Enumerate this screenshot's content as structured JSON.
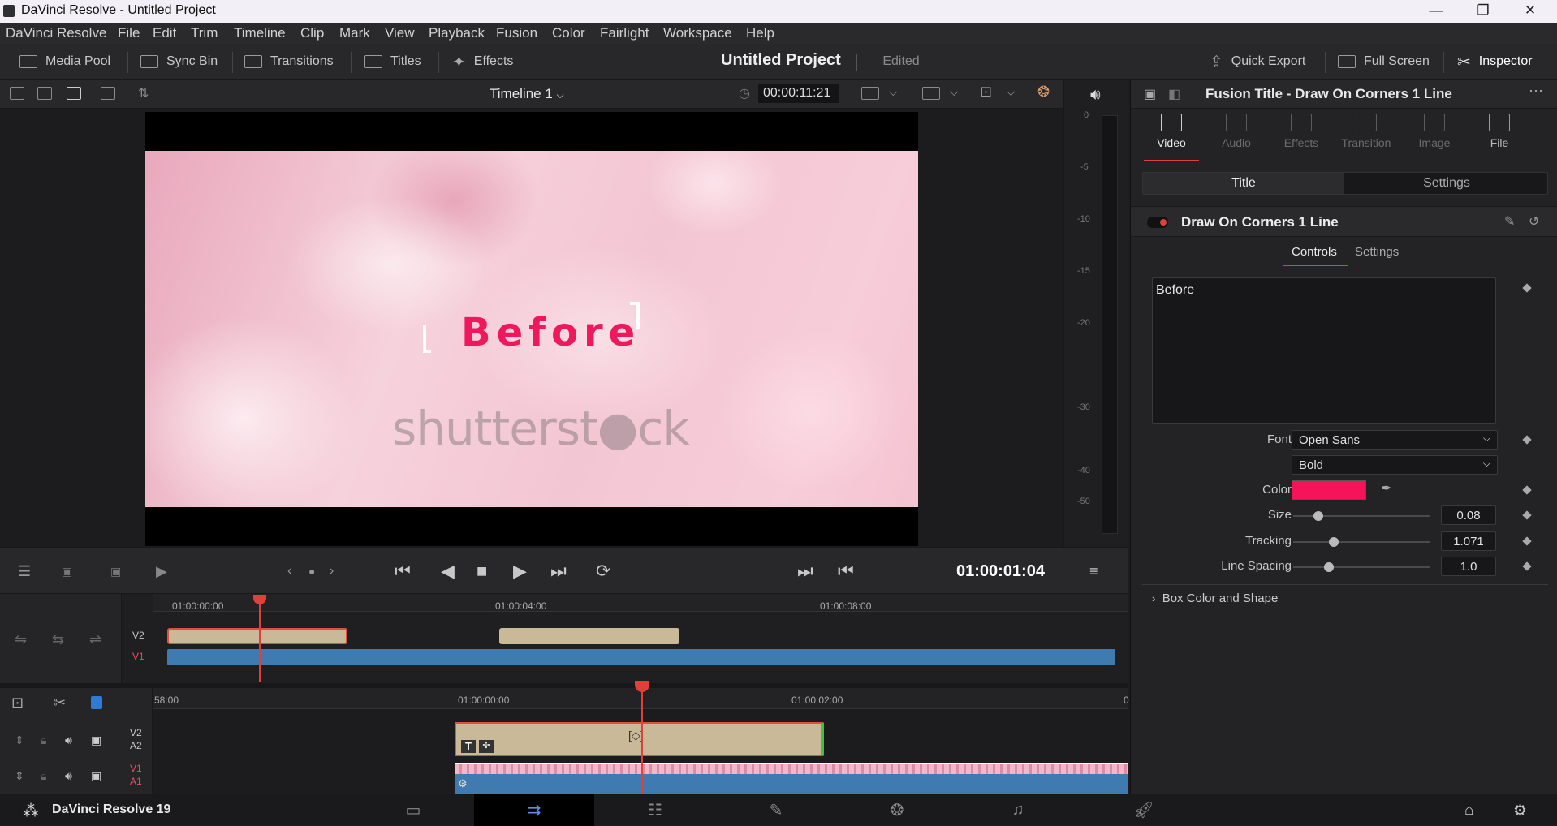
{
  "window": {
    "title": "DaVinci Resolve - Untitled Project",
    "controls": [
      "—",
      "❐",
      "✕"
    ]
  },
  "menu": [
    "DaVinci Resolve",
    "File",
    "Edit",
    "Trim",
    "Timeline",
    "Clip",
    "Mark",
    "View",
    "Playback",
    "Fusion",
    "Color",
    "Fairlight",
    "Workspace",
    "Help"
  ],
  "toolbar": {
    "media_pool": "Media Pool",
    "sync_bin": "Sync Bin",
    "transitions": "Transitions",
    "titles": "Titles",
    "effects": "Effects",
    "project": "Untitled Project",
    "edited": "Edited",
    "quick_export": "Quick Export",
    "full_screen": "Full Screen",
    "inspector": "Inspector"
  },
  "viewer": {
    "timeline_name": "Timeline 1",
    "timecode": "00:00:11:21",
    "title_text": "Before",
    "watermark": "shutterst●ck",
    "playhead_tc": "01:00:01:04"
  },
  "meter": {
    "ticks": [
      "0",
      "-5",
      "-10",
      "-15",
      "-20",
      "-30",
      "-40",
      "-50"
    ]
  },
  "mini_timeline": {
    "ruler": [
      "01:00:00:00",
      "01:00:04:00",
      "01:00:08:00"
    ],
    "tracks": [
      "V2",
      "V1"
    ]
  },
  "main_timeline": {
    "ruler": [
      "58:00",
      "01:00:00:00",
      "01:00:02:00",
      "0"
    ],
    "tracks": [
      {
        "v": "V2",
        "a": "A2"
      },
      {
        "v": "V1",
        "a": "A1"
      }
    ]
  },
  "inspector": {
    "header": "Fusion Title - Draw On Corners 1 Line",
    "tabs": [
      "Video",
      "Audio",
      "Effects",
      "Transition",
      "Image",
      "File"
    ],
    "subtabs": [
      "Title",
      "Settings"
    ],
    "effect_name": "Draw On Corners 1 Line",
    "ctrl_tabs": [
      "Controls",
      "Settings"
    ],
    "text_value": "Before",
    "font_label": "Font",
    "font": "Open Sans",
    "font_style": "Bold",
    "color_label": "Color",
    "color": "#f5135a",
    "size_label": "Size",
    "size": "0.08",
    "tracking_label": "Tracking",
    "tracking": "1.071",
    "spacing_label": "Line Spacing",
    "spacing": "1.0",
    "box_section": "Box Color and Shape"
  },
  "status": {
    "app": "DaVinci Resolve 19"
  }
}
